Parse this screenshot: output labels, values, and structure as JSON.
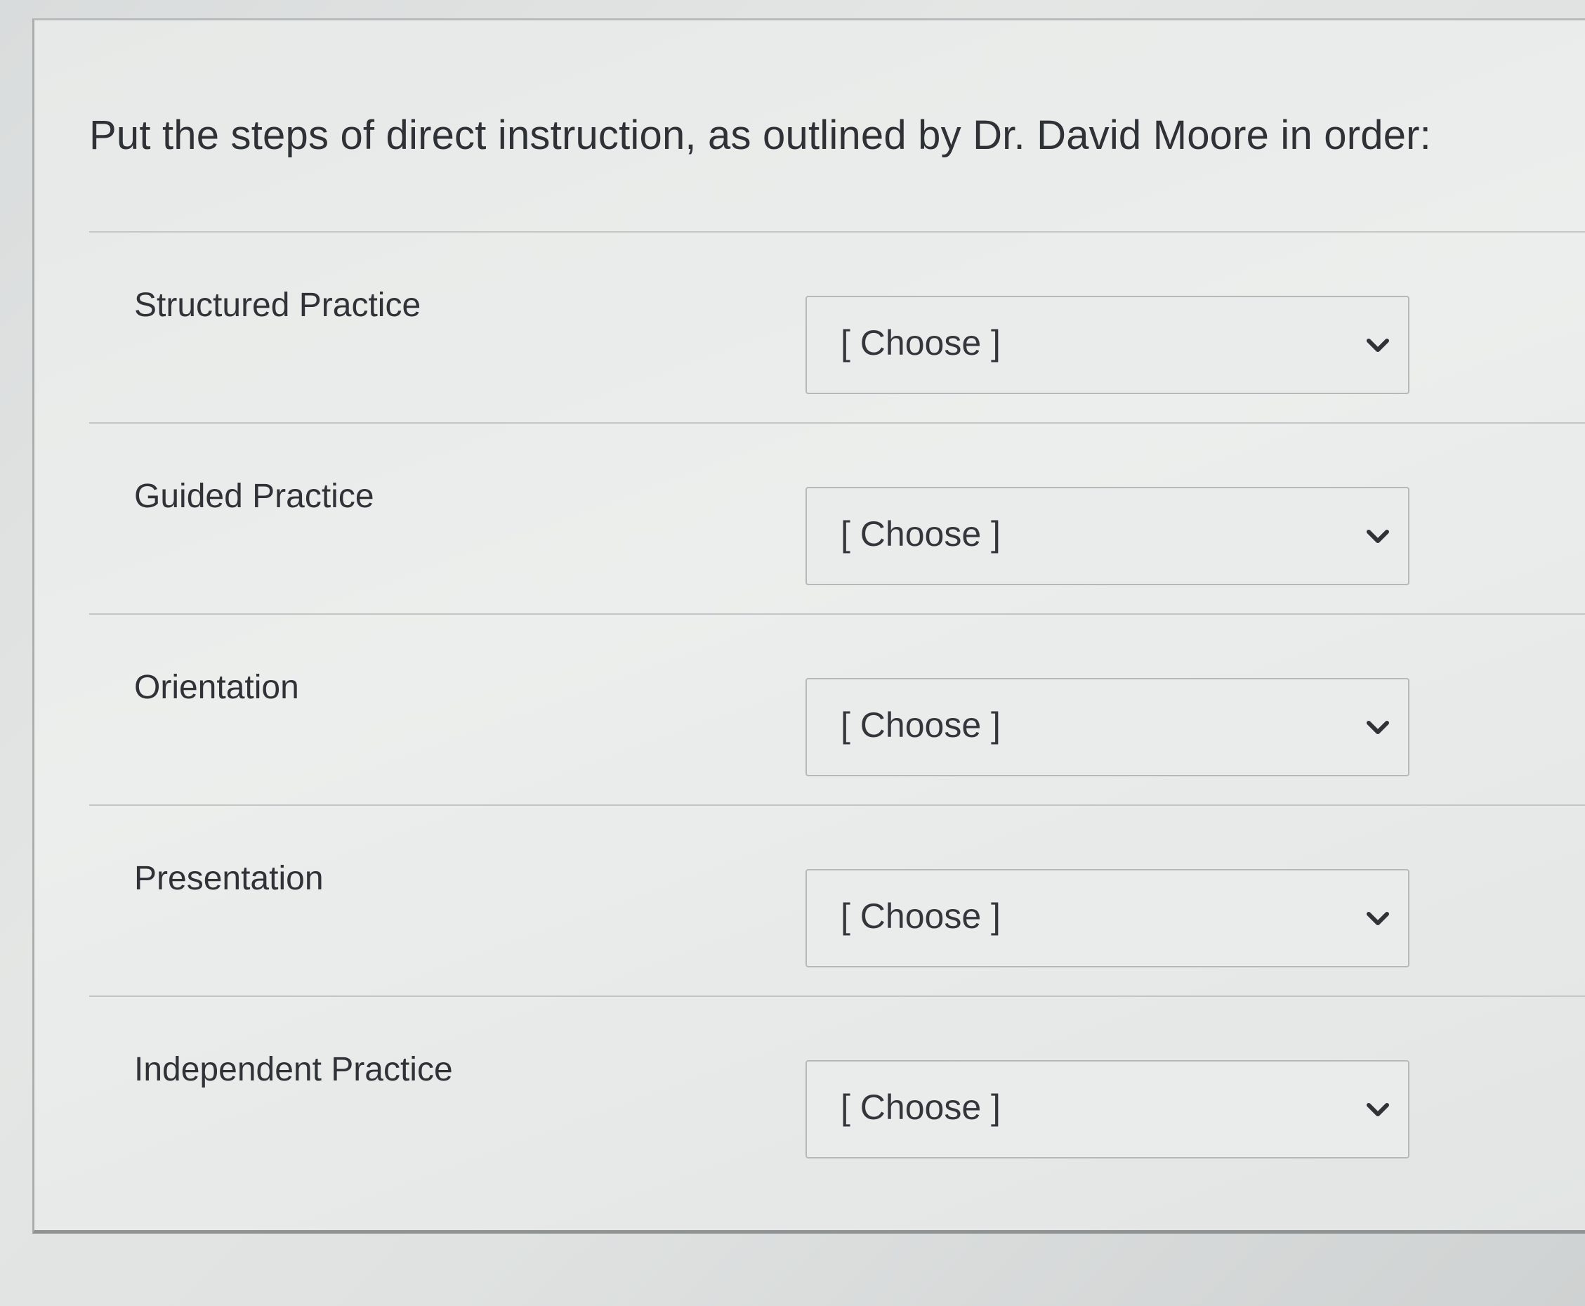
{
  "question": {
    "text": "Put the steps of direct instruction, as outlined by Dr. David Moore in order:"
  },
  "rows": [
    {
      "label": "Structured Practice",
      "selected": "[ Choose ]",
      "icon": "chevron-down-icon"
    },
    {
      "label": "Guided Practice",
      "selected": "[ Choose ]",
      "icon": "chevron-down-icon"
    },
    {
      "label": "Orientation",
      "selected": "[ Choose ]",
      "icon": "chevron-down-icon"
    },
    {
      "label": "Presentation",
      "selected": "[ Choose ]",
      "icon": "chevron-down-icon"
    },
    {
      "label": "Independent Practice",
      "selected": "[ Choose ]",
      "icon": "chevron-down-icon"
    }
  ],
  "colors": {
    "text": "#2e3236",
    "border": "#b6b9ba",
    "select_background": "#eaeceb",
    "card_background": "#eceeed"
  }
}
